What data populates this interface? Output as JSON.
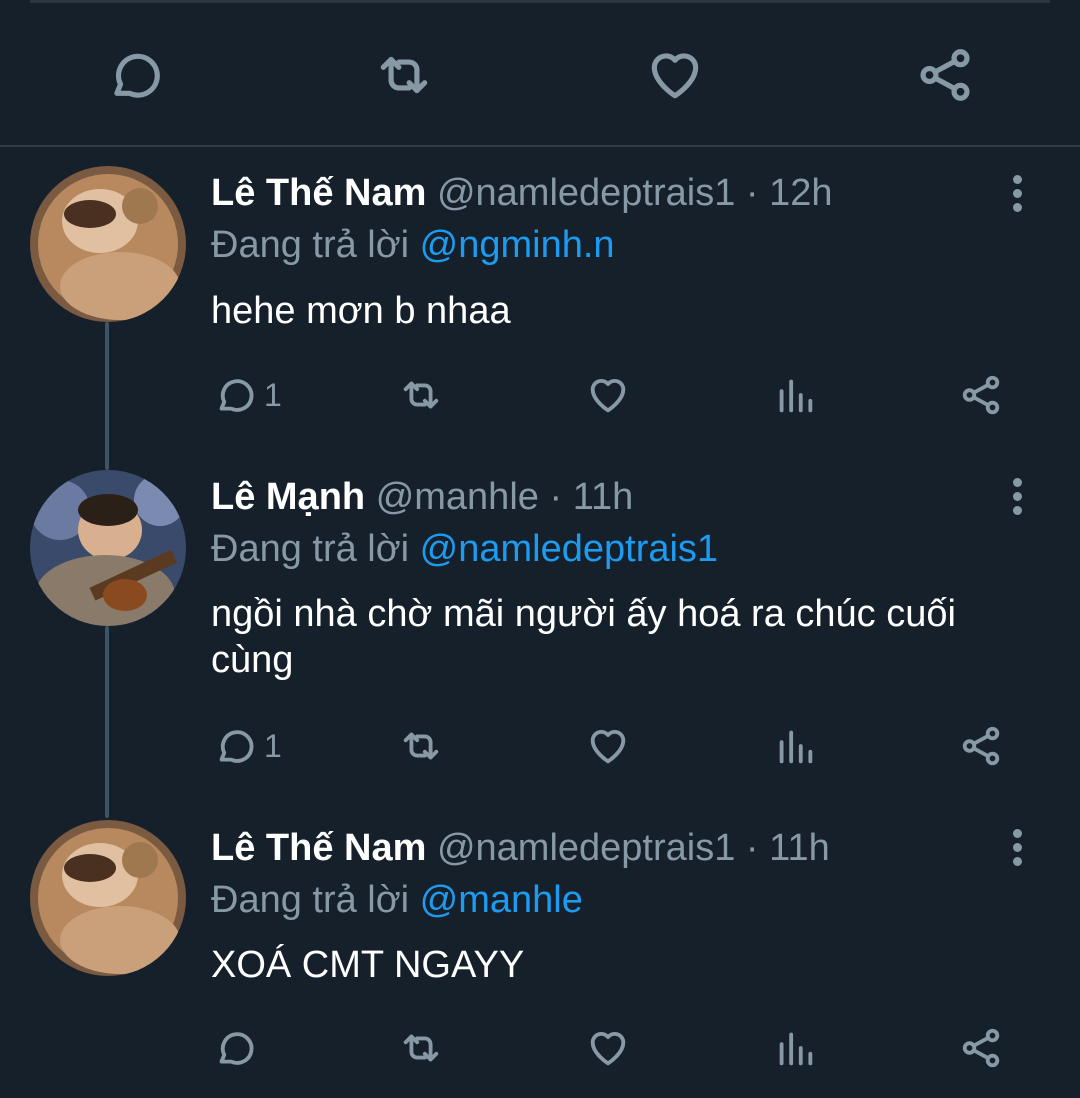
{
  "top_actions": {
    "reply_icon": "reply-icon",
    "retweet_icon": "retweet-icon",
    "like_icon": "heart-icon",
    "share_icon": "share-icon"
  },
  "tweets": [
    {
      "name": "Lê Thế Nam",
      "handle": "@namledeptrais1",
      "dot": "·",
      "time": "12h",
      "reply_prefix": "Đang trả lời",
      "reply_to": "@ngminh.n",
      "text": "hehe mơn b nhaa",
      "reply_count": "1"
    },
    {
      "name": "Lê Mạnh",
      "handle": "@manhle",
      "dot": "·",
      "time": "11h",
      "reply_prefix": "Đang trả lời",
      "reply_to": "@namledeptrais1",
      "text": "ngồi nhà chờ mãi người ấy hoá ra chúc cuối cùng",
      "reply_count": "1"
    },
    {
      "name": "Lê Thế Nam",
      "handle": "@namledeptrais1",
      "dot": "·",
      "time": "11h",
      "reply_prefix": "Đang trả lời",
      "reply_to": "@manhle",
      "text": "XOÁ CMT NGAYY",
      "reply_count": ""
    }
  ],
  "colors": {
    "background": "#15202b",
    "muted": "#8899a6",
    "accent": "#1d9bf0",
    "text": "#ffffff"
  }
}
